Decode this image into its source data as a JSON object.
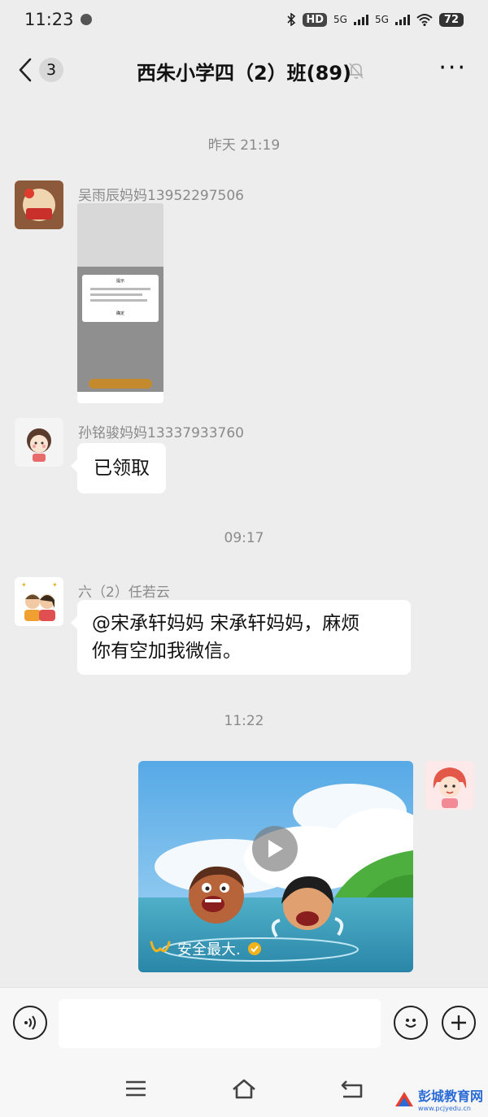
{
  "status_bar": {
    "time": "11:23",
    "hd_label": "HD",
    "network_1": "5G",
    "network_2": "5G",
    "battery": "72"
  },
  "nav": {
    "unread_count": "3",
    "title": "西朱小学四（2）班(89)"
  },
  "messages": [
    {
      "type": "timestamp",
      "text": "昨天 21:19"
    },
    {
      "type": "image",
      "sender": "吴雨辰妈妈13952297506",
      "shot_dialog_title": "提示",
      "shot_dialog_button": "确定"
    },
    {
      "type": "text",
      "sender": "孙铭骏妈妈13337933760",
      "text": "已领取"
    },
    {
      "type": "timestamp",
      "text": "09:17"
    },
    {
      "type": "text",
      "sender": "六（2）任若云",
      "line1": "@宋承轩妈妈  宋承轩妈妈，麻烦",
      "line2": "你有空加我微信。"
    },
    {
      "type": "timestamp",
      "text": "11:22"
    },
    {
      "type": "video",
      "caption": "安全最大."
    }
  ],
  "input": {
    "value": "",
    "placeholder": ""
  },
  "icons": {
    "back": "chevron-left-icon",
    "mute": "bell-mute-icon",
    "more": "more-icon",
    "voice": "voice-icon",
    "emoji": "emoji-icon",
    "add": "plus-icon",
    "menu": "menu-icon",
    "home": "home-icon",
    "return": "return-icon"
  },
  "watermark": {
    "main": "彭城教育网",
    "url": "www.pcjyedu.cn"
  },
  "colors": {
    "background": "#ededed",
    "bubble": "#ffffff",
    "muted_text": "#8a8a8a",
    "watermark": "#2a6bd6"
  }
}
